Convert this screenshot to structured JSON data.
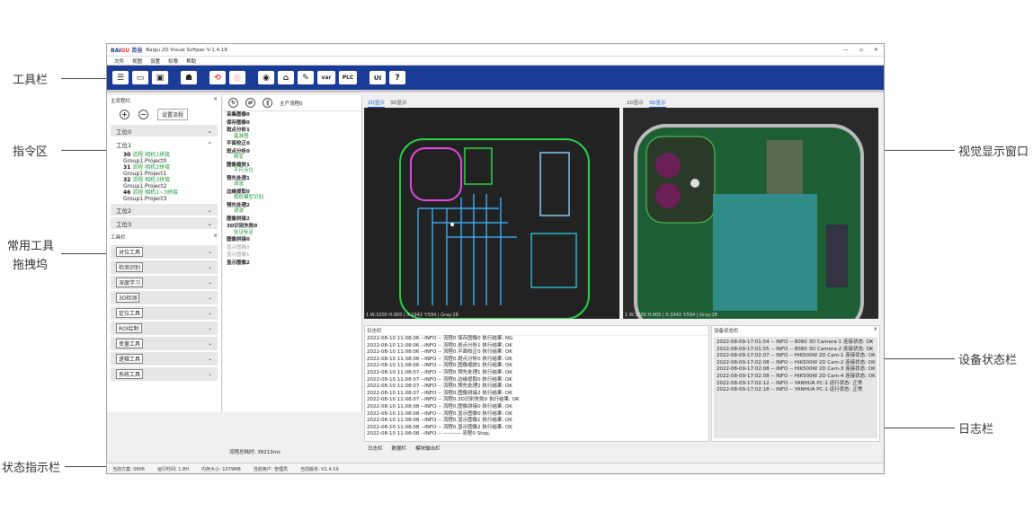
{
  "annotations": {
    "toolbar": "工具栏",
    "command_area": "指令区",
    "tool_dock_line1": "常用工具",
    "tool_dock_line2": "拖拽坞",
    "status_indicator": "状态指示栏",
    "vision_window": "视觉显示窗口",
    "device_status": "设备状态栏",
    "log_bar": "日志栏"
  },
  "window": {
    "logo_a": "BAI",
    "logo_b": "GU",
    "logo_c": "百谷",
    "title": "Baigu 2D Visual Softpac  V-1.4.19",
    "controls": [
      "—",
      "▫",
      "✕"
    ]
  },
  "menu": [
    "文件",
    "视图",
    "设置",
    "权限",
    "帮助"
  ],
  "toolbar": {
    "var_label": "var",
    "plc_label": "PLC",
    "ui_label": "UI",
    "help_label": "?"
  },
  "left_panel": {
    "title": "主流程栏",
    "close": "✕",
    "add": "+",
    "remove": "−",
    "set_flow": "设置流程",
    "groups": [
      {
        "label": "工位0"
      },
      {
        "label": "工位1"
      },
      {
        "label": "工位2"
      },
      {
        "label": "工位3"
      }
    ],
    "items": [
      {
        "num": "30",
        "flow": "流程 相机1拼接",
        "group": "Group1.Project0"
      },
      {
        "num": "31",
        "flow": "流程 相机2拼接",
        "group": "Group1.Project1"
      },
      {
        "num": "32",
        "flow": "流程 相机3拼接",
        "group": "Group1.Project2"
      },
      {
        "num": "46",
        "flow": "流程 相机1~3拼接",
        "group": "Group1.Project3"
      }
    ],
    "tool_title": "工具栏",
    "tool_close": "✕",
    "tools": [
      "对位工具",
      "检测识别",
      "深度学习",
      "3D检测",
      "定位工具",
      "ROI绘制",
      "变量工具",
      "逻辑工具",
      "系统工具"
    ]
  },
  "mid_panel": {
    "flow_name": "主产流程0",
    "rows": [
      {
        "t": "采集图像0",
        "s": ""
      },
      {
        "t": "保存图像0",
        "s": ""
      },
      {
        "t": "斑点分析1",
        "s": "基准图"
      },
      {
        "t": "平面校正0",
        "s": ""
      },
      {
        "t": "斑点分析0",
        "s": "畸变"
      },
      {
        "t": "图像缩放1",
        "s": "平尺点位"
      },
      {
        "t": "预先处理1",
        "s": "滤波"
      },
      {
        "t": "边缘提取0",
        "s": "相机模型识别"
      },
      {
        "t": "预先处理2",
        "s": "滤波"
      },
      {
        "t": "图像拼接2",
        "s": ""
      },
      {
        "t": "3D识别失败0",
        "s": "验证标定"
      },
      {
        "t": "图像拼接0",
        "s": ""
      },
      {
        "t": "显示图像0",
        "s": "",
        "grey": true
      },
      {
        "t": "显示图像1",
        "s": "",
        "grey": true
      },
      {
        "t": "显示图像2",
        "s": ""
      }
    ],
    "flow_time": "流程总耗时:  38213ms"
  },
  "view_left": {
    "tab2d": "2D显示",
    "tab3d": "3D显示",
    "status": "1   W:3200 H:900 | X:1942 Y:594 | Gray:28"
  },
  "view_right": {
    "tab2d": "2D显示",
    "tab3d": "3D显示",
    "status": "1   W:3200 H:900 | X:1942 Y:594 | Gray:28"
  },
  "log": {
    "title": "日志栏",
    "lines": [
      "2022-08-10 11:08:06 --INFO -- 流程0.保存图像0 执行结果: NG",
      "2022-08-10 11:08:06 --INFO -- 流程0.斑点分析1 执行结果: OK",
      "2022-08-10 11:08:06 --INFO -- 流程0.平面校正0 执行结果: OK",
      "2022-08-10 11:08:06 --INFO -- 流程0.斑点分析0 执行结果: OK",
      "2022-08-10 11:08:06 --INFO -- 流程0.图像缩放1 执行结果: OK",
      "2022-08-10 11:08:07 --INFO -- 流程0.预先处理1 执行结果: OK",
      "2022-08-10 11:08:07 --INFO -- 流程0.边缘提取0 执行结果: OK",
      "2022-08-10 11:08:07 --INFO -- 流程0.预先处理2 执行结果: OK",
      "2022-08-10 11:08:07 --INFO -- 流程0.图像拼接2 执行结果: OK",
      "2022-08-10 11:08:07 --INFO -- 流程0.3D识别失败0 执行结果: OK",
      "2022-08-10 11:08:08 --INFO -- 流程0.图像拼接0 执行结果: OK",
      "2022-08-10 11:08:08 --INFO -- 流程0.显示图像0 执行结果: OK",
      "2022-08-10 11:08:08 --INFO -- 流程0.显示图像1 执行结果: OK",
      "2022-08-10 11:08:08 --INFO -- 流程0.显示图像2 执行结果: OK",
      "2022-08-10 11:08:08 --INFO -- ---------- 流程0 Stop。"
    ],
    "tabs": [
      "日志栏",
      "数据栏",
      "模块输出栏"
    ]
  },
  "device": {
    "title": "设备状态栏",
    "close": "✕",
    "lines": [
      "2022-08-09-17:01:54 -- INFO -- 8080 3D Camera-1 连接状态: OK",
      "2022-08-09-17:01:55 -- INFO -- 8080 3D Camera-2 连接状态: OK",
      "2022-08-09-17:02:07 -- INFO -- HIK500W 2D Cam-1 连接状态: OK",
      "2022-08-09-17:02:08 -- INFO -- HIK500W 2D Cam-2 连接状态: OK",
      "2022-08-09-17:02:08 -- INFO -- HIK500W 2D Cam-3 连接状态: OK",
      "2022-08-09-17:02:08 -- INFO -- HIK500W 2D Cam-4 连接状态: OK",
      "2022-08-09-17:02:12 -- INFO -- YANHUA PC-1 运行状态: 正常",
      "2022-08-09-17:02:18 -- INFO -- YANHUA PC-1 运行状态: 正常"
    ]
  },
  "status_bar": {
    "items": [
      "当前方案: 0606",
      "运行时间: 1.8H",
      "内存大小: 1079MB",
      "当前用户: 管理员",
      "当前版本: V1.4.19"
    ]
  }
}
